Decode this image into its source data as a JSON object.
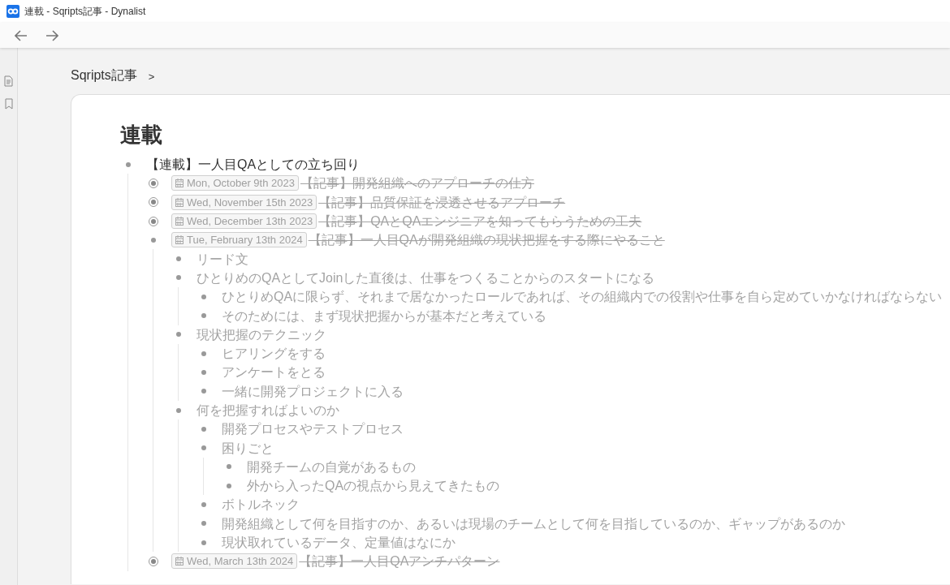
{
  "window": {
    "title": "連載 - Sqripts記事 - Dynalist"
  },
  "breadcrumb": {
    "label": "Sqripts記事",
    "separator": ">"
  },
  "document": {
    "title": "連載",
    "items": [
      {
        "text": "【連載】一人目QAとしての立ち回り",
        "completed": false,
        "collapsed": false,
        "children": [
          {
            "date": "Mon, October 9th 2023",
            "text": "【記事】開発組織へのアプローチの仕方",
            "completed": true,
            "collapsed": true
          },
          {
            "date": "Wed, November 15th 2023",
            "text": "【記事】品質保証を浸透させるアプローチ",
            "completed": true,
            "collapsed": true
          },
          {
            "date": "Wed, December 13th 2023",
            "text": "【記事】QAとQAエンジニアを知ってもらうための工夫",
            "completed": true,
            "collapsed": true
          },
          {
            "date": "Tue, February 13th 2024",
            "text": "【記事】一人目QAが開発組織の現状把握をする際にやること",
            "completed": true,
            "collapsed": false,
            "children": [
              {
                "text": "リード文",
                "completed": false,
                "collapsed": false
              },
              {
                "text": "ひとりめのQAとしてJoinした直後は、仕事をつくることからのスタートになる",
                "completed": false,
                "collapsed": false,
                "children": [
                  {
                    "text": "ひとりめQAに限らず、それまで居なかったロールであれば、その組織内での役割や仕事を自ら定めていかなければならない",
                    "completed": false,
                    "collapsed": false
                  },
                  {
                    "text": "そのためには、まず現状把握からが基本だと考えている",
                    "completed": false,
                    "collapsed": false
                  }
                ]
              },
              {
                "text": "現状把握のテクニック",
                "completed": false,
                "collapsed": false,
                "children": [
                  {
                    "text": "ヒアリングをする",
                    "completed": false,
                    "collapsed": false
                  },
                  {
                    "text": "アンケートをとる",
                    "completed": false,
                    "collapsed": false
                  },
                  {
                    "text": "一緒に開発プロジェクトに入る",
                    "completed": false,
                    "collapsed": false
                  }
                ]
              },
              {
                "text": "何を把握すればよいのか",
                "completed": false,
                "collapsed": false,
                "children": [
                  {
                    "text": "開発プロセスやテストプロセス",
                    "completed": false,
                    "collapsed": false
                  },
                  {
                    "text": "困りごと",
                    "completed": false,
                    "collapsed": false,
                    "children": [
                      {
                        "text": "開発チームの自覚があるもの",
                        "completed": false,
                        "collapsed": false
                      },
                      {
                        "text": "外から入ったQAの視点から見えてきたもの",
                        "completed": false,
                        "collapsed": false
                      }
                    ]
                  },
                  {
                    "text": "ボトルネック",
                    "completed": false,
                    "collapsed": false
                  },
                  {
                    "text": "開発組織として何を目指すのか、あるいは現場のチームとして何を目指しているのか、ギャップがあるのか",
                    "completed": false,
                    "collapsed": false
                  },
                  {
                    "text": "現状取れているデータ、定量値はなにか",
                    "completed": false,
                    "collapsed": false
                  }
                ]
              }
            ]
          },
          {
            "date": "Wed, March 13th 2024",
            "text": "【記事】一人目QAアンチパターン",
            "completed": true,
            "collapsed": true
          }
        ]
      }
    ]
  }
}
